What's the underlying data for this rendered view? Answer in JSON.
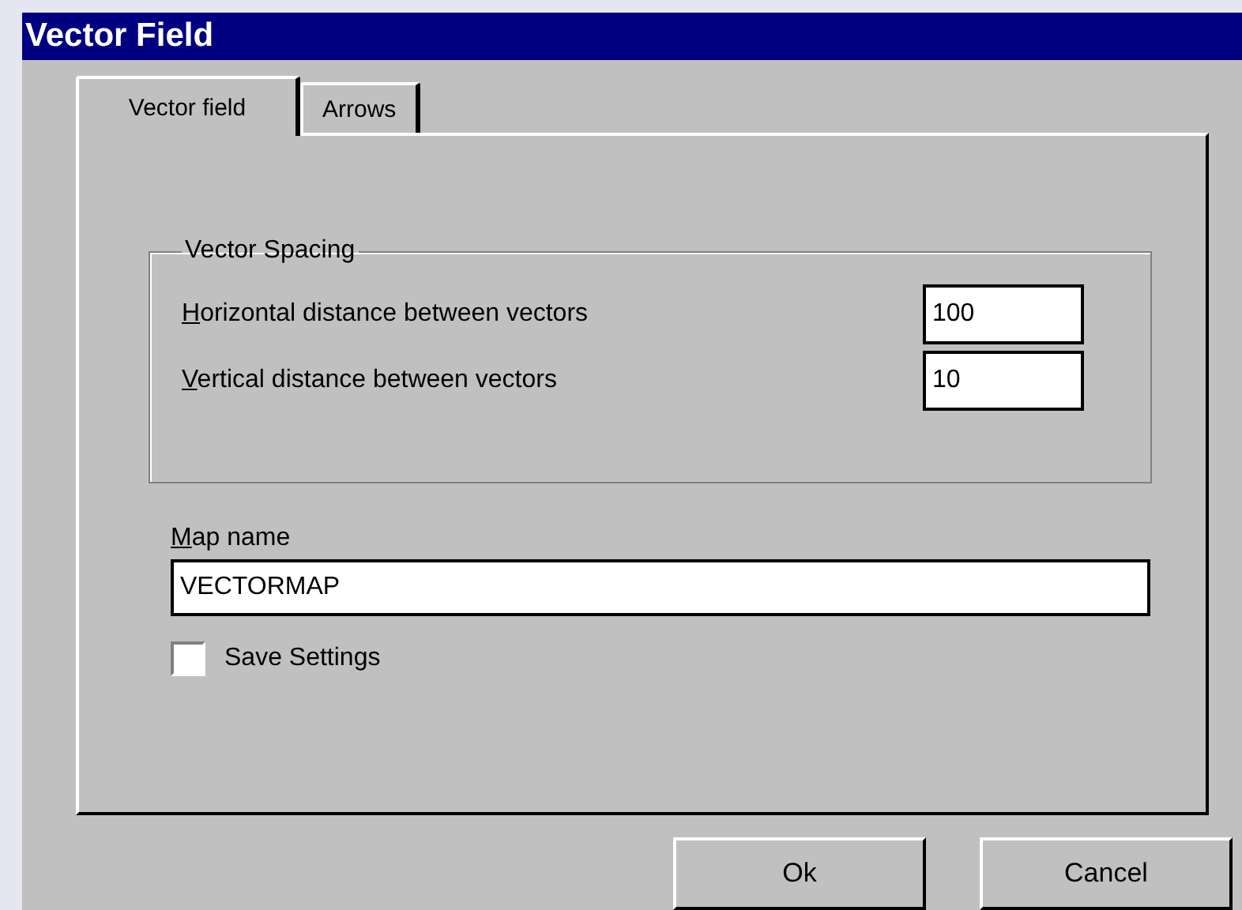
{
  "window": {
    "title": "Vector Field"
  },
  "tabs": [
    {
      "label": "Vector field",
      "selected": true
    },
    {
      "label": "Arrows",
      "selected": false
    }
  ],
  "group": {
    "title": "Vector Spacing",
    "fields": [
      {
        "key": "H",
        "rest": "orizontal distance between vectors",
        "value": "100"
      },
      {
        "key": "V",
        "rest": "ertical distance between vectors",
        "value": "10"
      }
    ]
  },
  "map_name": {
    "key": "M",
    "rest": "ap name",
    "value": "VECTORMAP"
  },
  "save_settings": {
    "label": "Save Settings",
    "checked": false
  },
  "buttons": [
    "Ok",
    "Cancel"
  ]
}
